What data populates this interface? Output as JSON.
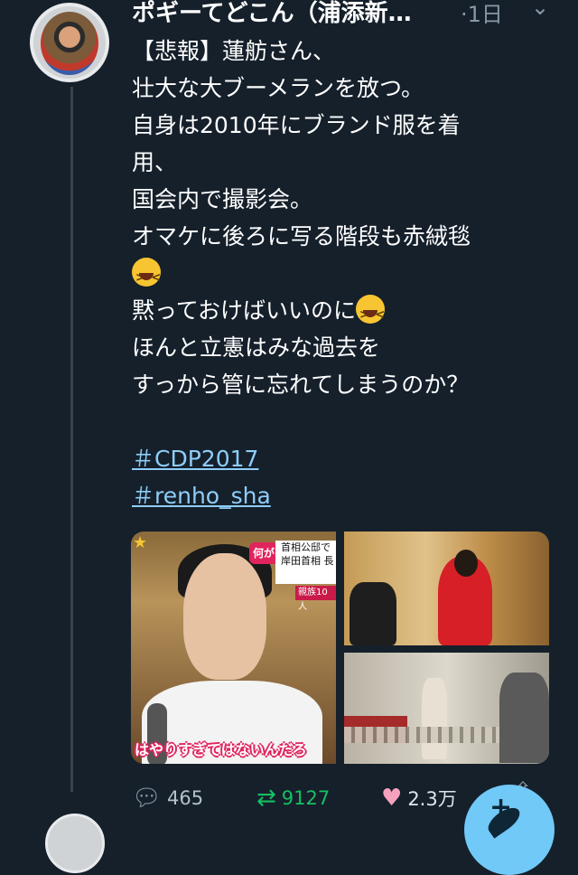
{
  "tweet": {
    "display_name": "ポギーてどこん（浦添新…",
    "time_sep": "·",
    "time": "1日",
    "text_lines": [
      "【悲報】蓮舫さん、",
      "壮大な大ブーメランを放つ。",
      "自身は2010年にブランド服を着",
      "用、",
      "国会内で撮影会。",
      "オマケに後ろに写る階段も赤絨毯",
      "",
      "黙っておけばいいのに",
      "ほんと立憲はみな過去を",
      "すっから管に忘れてしまうのか？"
    ],
    "emoji_name": "grinning-squinting-face-icon",
    "hashtags": [
      "＃CDP2017",
      "＃renho_sha"
    ],
    "media_overlay": {
      "tag": "何が",
      "headline_1": "首相公邸で",
      "headline_2": "岸田首相 長",
      "sub": "親族10人",
      "caption": "はやりすぎてはないんだろ"
    },
    "actions": {
      "reply_count": "465",
      "retweet_count": "9127",
      "like_count": "2.3万"
    }
  },
  "colors": {
    "background": "#15202b",
    "retweet": "#17bf63",
    "like": "#f5a1bf",
    "link": "#8ecdf8",
    "fab": "#71c9f8"
  }
}
